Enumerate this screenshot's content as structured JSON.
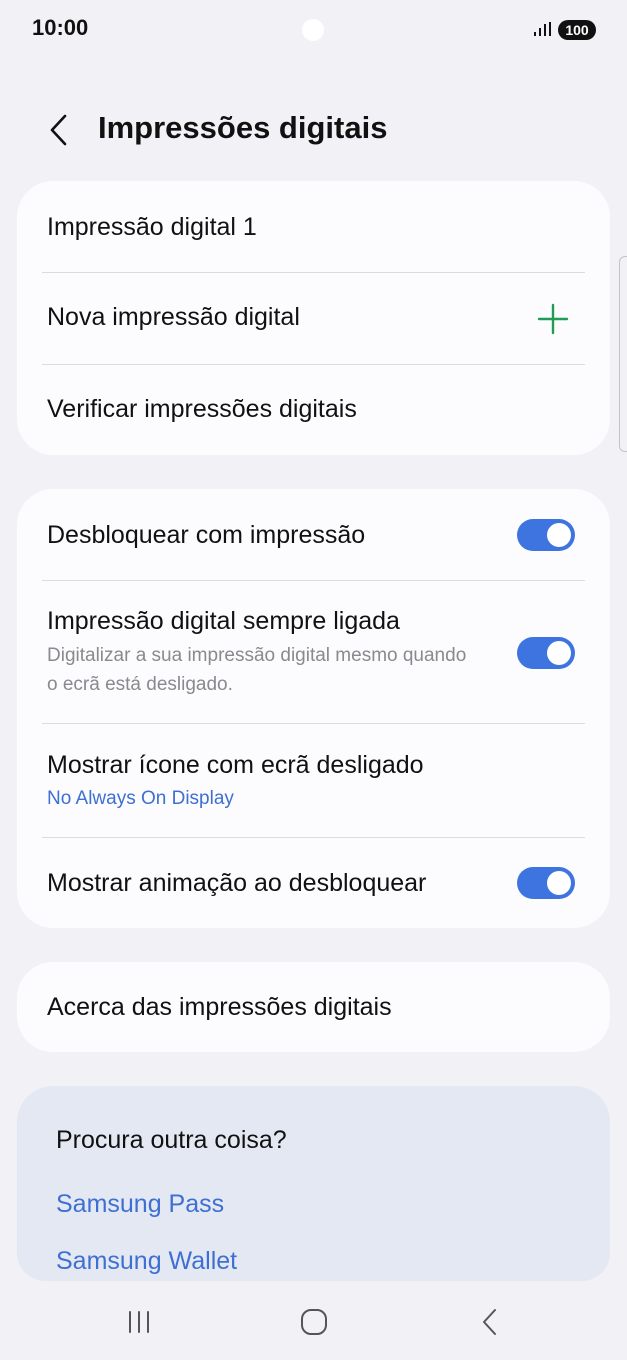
{
  "status_bar": {
    "time": "10:00",
    "battery": "100",
    "signal_icon": "signal-bars-icon"
  },
  "header": {
    "back_icon": "chevron-left-icon",
    "title": "Impressões digitais"
  },
  "fingerprints_card": {
    "items": [
      {
        "label": "Impressão digital 1"
      },
      {
        "label": "Nova impressão digital",
        "icon": "plus-icon",
        "icon_color": "#1f9d55"
      },
      {
        "label": "Verificar impressões digitais"
      }
    ]
  },
  "settings_card": {
    "items": [
      {
        "label": "Desbloquear com impressão",
        "toggle": true
      },
      {
        "label": "Impressão digital sempre ligada",
        "sub": "Digitalizar a sua impressão digital mesmo quando o ecrã está desligado.",
        "toggle": true
      },
      {
        "label": "Mostrar ícone com ecrã desligado",
        "sub": "No Always On Display"
      },
      {
        "label": "Mostrar animação ao desbloquear",
        "toggle": true
      }
    ]
  },
  "about_card": {
    "label": "Acerca das impressões digitais"
  },
  "suggestions": {
    "title": "Procura outra coisa?",
    "links": [
      "Samsung Pass",
      "Samsung Wallet"
    ]
  },
  "nav_bar": {
    "icons": [
      "recent-apps-icon",
      "home-icon",
      "back-icon"
    ]
  },
  "colors": {
    "accent": "#3d74e0",
    "link": "#3e6fd2",
    "background": "#f2f2f6",
    "card": "#fcfcfe",
    "suggest_bg": "#e4e8f3"
  }
}
